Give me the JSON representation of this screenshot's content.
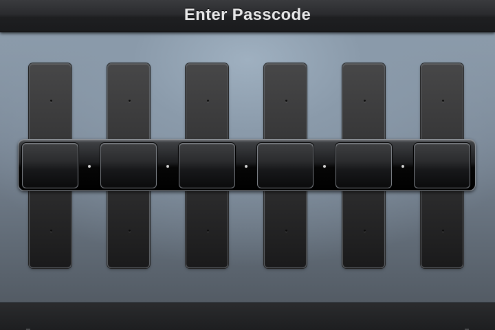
{
  "header": {
    "title": "Enter Passcode"
  },
  "passcode": {
    "digit_count": 6,
    "entered_count": 0
  },
  "colors": {
    "title_text": "#e9e9ea",
    "panel_top": "#9fb0c0",
    "panel_bottom": "#535b64",
    "reel": "#3a3a3b",
    "track": "#060606"
  }
}
